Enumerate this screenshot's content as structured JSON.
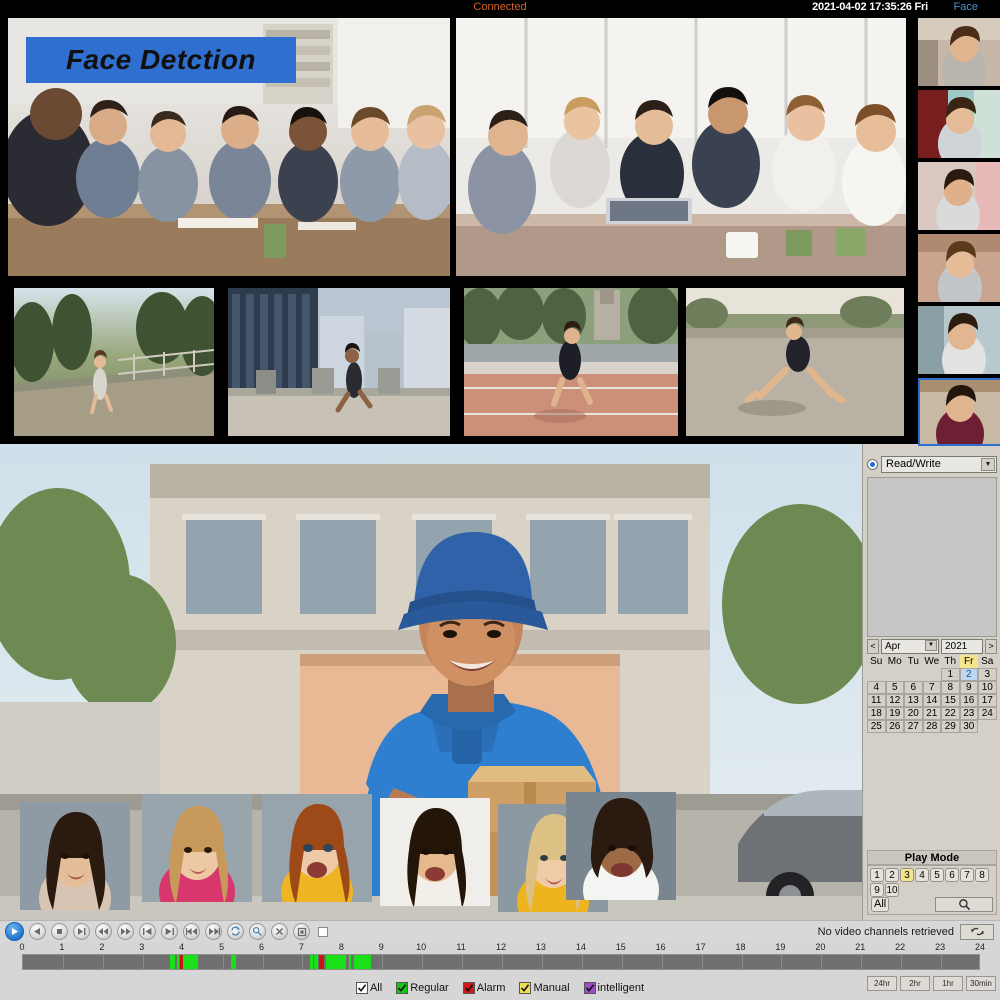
{
  "topbar": {
    "status": "Connected",
    "datetime": "2021-04-02 17:35:26 Fri",
    "face_tab": "Face",
    "status_color": "#d4622a",
    "face_tab_color": "#4d8fd6"
  },
  "overlay": {
    "banner_text": "Face Detction",
    "banner_bg": "#2f6fd0"
  },
  "surveillance": {
    "cells": [
      {
        "name": "channel-1",
        "label": "",
        "scene": "meeting-room-team"
      },
      {
        "name": "channel-2",
        "label": "",
        "scene": "office-team-laptop"
      },
      {
        "name": "channel-3",
        "label": "",
        "scene": "runner-park-path"
      },
      {
        "name": "channel-4",
        "label": "",
        "scene": "runner-city-plaza"
      },
      {
        "name": "channel-5",
        "label": "",
        "scene": "runner-bridge-track"
      },
      {
        "name": "channel-6",
        "label": "",
        "scene": "runner-road-stretch"
      }
    ],
    "face_snapshots": [
      {
        "name": "face-snapshot-1",
        "scene": "woman-store-aisle"
      },
      {
        "name": "face-snapshot-2",
        "scene": "woman-fridge-aisle"
      },
      {
        "name": "face-snapshot-3",
        "scene": "woman-pink-shelf"
      },
      {
        "name": "face-snapshot-4",
        "scene": "woman-smiling-shop"
      },
      {
        "name": "face-snapshot-5",
        "scene": "woman-profile-store"
      },
      {
        "name": "face-snapshot-6",
        "scene": "woman-maroon-top",
        "selected": true
      }
    ]
  },
  "playback": {
    "main_scene": "delivery-courier-boxes",
    "face_overlays": [
      {
        "name": "playback-face-1",
        "scene": "woman-beige-top"
      },
      {
        "name": "playback-face-2",
        "scene": "woman-pink-top"
      },
      {
        "name": "playback-face-3",
        "scene": "woman-yellow-scarf"
      },
      {
        "name": "playback-face-4",
        "scene": "woman-white-turtleneck"
      },
      {
        "name": "playback-face-5",
        "scene": "woman-yellow-sweater"
      },
      {
        "name": "playback-face-6",
        "scene": "woman-white-shirt"
      }
    ]
  },
  "right_panel": {
    "mode_select": {
      "value": "Read/Write",
      "radio_selected": true
    },
    "file_list": {
      "items": []
    },
    "calendar": {
      "prev_label": "<",
      "next_label": ">",
      "month": "Apr",
      "year": "2021",
      "dow": [
        "Su",
        "Mo",
        "Tu",
        "We",
        "Th",
        "Fr",
        "Sa"
      ],
      "highlighted_dow": "Fr",
      "leading_blanks": 4,
      "days": [
        1,
        2,
        3,
        4,
        5,
        6,
        7,
        8,
        9,
        10,
        11,
        12,
        13,
        14,
        15,
        16,
        17,
        18,
        19,
        20,
        21,
        22,
        23,
        24,
        25,
        26,
        27,
        28,
        29,
        30
      ],
      "selected_day": 2
    },
    "play_mode": {
      "title": "Play Mode",
      "channels": [
        "1",
        "2",
        "3",
        "4",
        "5",
        "6",
        "7",
        "8",
        "9",
        "10"
      ],
      "selected_channel": "3",
      "all_label": "All",
      "search_icon": "magnifier-icon"
    }
  },
  "transport": {
    "buttons": [
      {
        "name": "play-button",
        "icon": "play-icon",
        "primary": true
      },
      {
        "name": "reverse-play-button",
        "icon": "reverse-play-icon"
      },
      {
        "name": "stop-button",
        "icon": "stop-icon"
      },
      {
        "name": "slow-play-button",
        "icon": "slow-play-icon"
      },
      {
        "name": "rewind-button",
        "icon": "rewind-icon"
      },
      {
        "name": "fast-forward-button",
        "icon": "fast-forward-icon"
      },
      {
        "name": "previous-frame-button",
        "icon": "previous-frame-icon"
      },
      {
        "name": "next-frame-button",
        "icon": "next-frame-icon"
      },
      {
        "name": "previous-file-button",
        "icon": "previous-file-icon"
      },
      {
        "name": "next-file-button",
        "icon": "next-file-icon"
      },
      {
        "name": "repeat-button",
        "icon": "loop-icon"
      },
      {
        "name": "sync-button",
        "icon": "sync-icon"
      },
      {
        "name": "clear-button",
        "icon": "close-icon"
      },
      {
        "name": "snapshot-button",
        "icon": "snapshot-icon"
      }
    ],
    "stop_checkbox": {
      "name": "full-stop-checkbox",
      "checked": false
    },
    "status_text": "No video channels retrieved",
    "refresh_icon": "refresh-icon"
  },
  "timeline": {
    "hour_ticks": [
      "0",
      "1",
      "2",
      "3",
      "4",
      "5",
      "6",
      "7",
      "8",
      "9",
      "10",
      "11",
      "12",
      "13",
      "14",
      "15",
      "16",
      "17",
      "18",
      "19",
      "20",
      "21",
      "22",
      "23",
      "24"
    ],
    "range_start_hour": 0,
    "range_end_hour": 24,
    "segments": [
      {
        "start": 3.68,
        "end": 3.82,
        "type": "Regular",
        "color": "#19e019"
      },
      {
        "start": 3.86,
        "end": 3.92,
        "type": "Regular",
        "color": "#19e019"
      },
      {
        "start": 3.94,
        "end": 4.0,
        "type": "Alarm",
        "color": "#c81414"
      },
      {
        "start": 4.02,
        "end": 4.38,
        "type": "Regular",
        "color": "#19e019"
      },
      {
        "start": 5.2,
        "end": 5.34,
        "type": "Regular",
        "color": "#19e019"
      },
      {
        "start": 7.18,
        "end": 7.26,
        "type": "Regular",
        "color": "#19e019"
      },
      {
        "start": 7.3,
        "end": 7.38,
        "type": "Regular",
        "color": "#19e019"
      },
      {
        "start": 7.42,
        "end": 7.55,
        "type": "Alarm",
        "color": "#c81414"
      },
      {
        "start": 7.6,
        "end": 8.1,
        "type": "Regular",
        "color": "#19e019"
      },
      {
        "start": 8.16,
        "end": 8.22,
        "type": "Regular",
        "color": "#19e019"
      },
      {
        "start": 8.28,
        "end": 8.72,
        "type": "Regular",
        "color": "#19e019"
      }
    ]
  },
  "legend": {
    "items": [
      {
        "name": "legend-all",
        "label": "All",
        "color": "#ffffff",
        "checked": true
      },
      {
        "name": "legend-regular",
        "label": "Regular",
        "color": "#19c419",
        "checked": true
      },
      {
        "name": "legend-alarm",
        "label": "Alarm",
        "color": "#d01818",
        "checked": true
      },
      {
        "name": "legend-manual",
        "label": "Manual",
        "color": "#eede52",
        "checked": true
      },
      {
        "name": "legend-intelligent",
        "label": "intelligent",
        "color": "#9b4fc8",
        "checked": true
      }
    ]
  },
  "zoom_buttons": [
    {
      "name": "zoom-24hr",
      "label": "24hr"
    },
    {
      "name": "zoom-2hr",
      "label": "2hr"
    },
    {
      "name": "zoom-1hr",
      "label": "1hr"
    },
    {
      "name": "zoom-30min",
      "label": "30min"
    }
  ]
}
